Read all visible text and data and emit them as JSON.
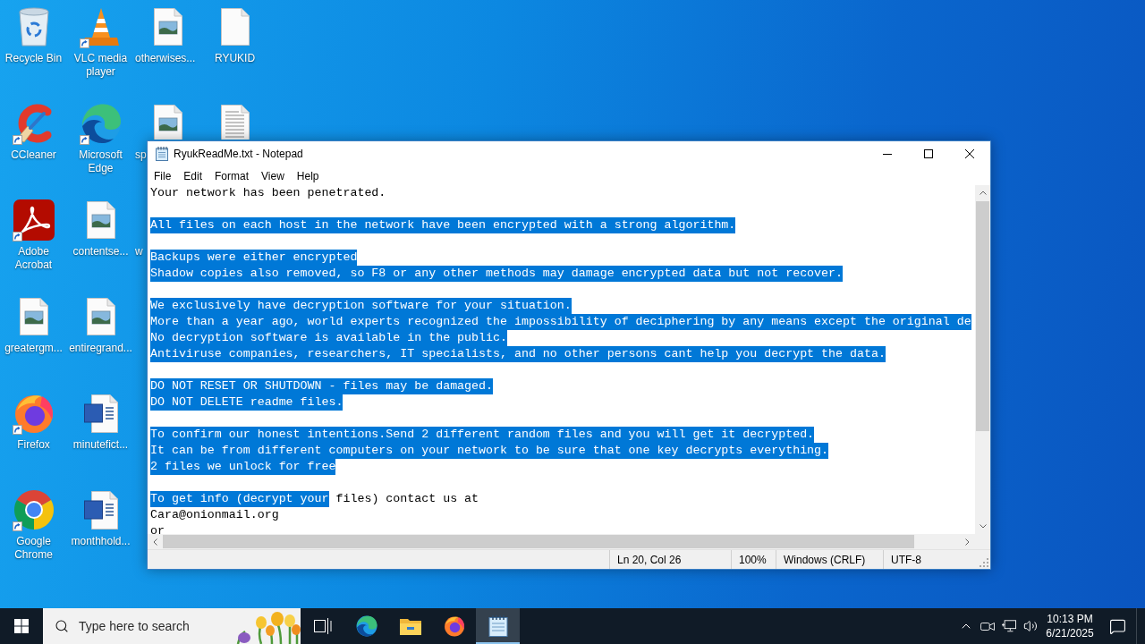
{
  "desktop": {
    "columns": [
      {
        "icons": [
          {
            "kind": "recycle-bin",
            "label": "Recycle Bin",
            "shortcut": false
          },
          {
            "kind": "ccleaner",
            "label": "CCleaner",
            "shortcut": true
          },
          {
            "kind": "acrobat",
            "label": "Adobe Acrobat",
            "shortcut": true
          },
          {
            "kind": "image-file",
            "label": "greatergm...",
            "shortcut": false
          },
          {
            "kind": "firefox",
            "label": "Firefox",
            "shortcut": true
          },
          {
            "kind": "chrome",
            "label": "Google Chrome",
            "shortcut": true
          }
        ]
      },
      {
        "icons": [
          {
            "kind": "vlc",
            "label": "VLC media player",
            "shortcut": true
          },
          {
            "kind": "edge",
            "label": "Microsoft Edge",
            "shortcut": true
          },
          {
            "kind": "image-file",
            "label": "contentse...",
            "shortcut": false
          },
          {
            "kind": "image-file",
            "label": "entiregrand...",
            "shortcut": false
          },
          {
            "kind": "word-document",
            "label": "minutefict...",
            "shortcut": false
          },
          {
            "kind": "word-document",
            "label": "monthhold...",
            "shortcut": false
          }
        ]
      },
      {
        "icons": [
          {
            "kind": "image-file",
            "label": "otherwises...",
            "shortcut": false
          },
          {
            "kind": "image-file",
            "label": "sp",
            "shortcut": false
          },
          {
            "label": "w"
          }
        ]
      },
      {
        "icons": [
          {
            "kind": "blank-file",
            "label": "RYUKID",
            "shortcut": false
          },
          {
            "kind": "text-file",
            "shortcut": false
          }
        ]
      }
    ]
  },
  "window": {
    "title": "RyukReadMe.txt - Notepad",
    "menu": [
      "File",
      "Edit",
      "Format",
      "View",
      "Help"
    ],
    "lines": [
      {
        "kind": "text",
        "spans": [
          {
            "text": "Your network has been penetrated.",
            "selected": false
          }
        ]
      },
      {
        "kind": "blank"
      },
      {
        "kind": "text",
        "spans": [
          {
            "text": "All files on each host in the network have been encrypted with a strong algorithm.",
            "selected": true
          }
        ]
      },
      {
        "kind": "blank"
      },
      {
        "kind": "text",
        "spans": [
          {
            "text": "Backups were either encrypted",
            "selected": true
          }
        ]
      },
      {
        "kind": "text",
        "spans": [
          {
            "text": "Shadow copies also removed, so F8 or any other methods may damage encrypted data but not recover.",
            "selected": true
          }
        ]
      },
      {
        "kind": "blank"
      },
      {
        "kind": "text",
        "spans": [
          {
            "text": "We exclusively have decryption software for your situation.",
            "selected": true
          }
        ]
      },
      {
        "kind": "text",
        "spans": [
          {
            "text": "More than a year ago, world experts recognized the impossibility of deciphering by any means except the original de",
            "selected": true
          }
        ]
      },
      {
        "kind": "text",
        "spans": [
          {
            "text": "No decryption software is available in the public.",
            "selected": true
          }
        ]
      },
      {
        "kind": "text",
        "spans": [
          {
            "text": "Antiviruse companies, researchers, IT specialists, and no other persons cant help you decrypt the data.",
            "selected": true
          }
        ]
      },
      {
        "kind": "blank"
      },
      {
        "kind": "text",
        "spans": [
          {
            "text": "DO NOT RESET OR SHUTDOWN - files may be damaged.",
            "selected": true
          }
        ]
      },
      {
        "kind": "text",
        "spans": [
          {
            "text": "DO NOT DELETE readme files.",
            "selected": true
          }
        ]
      },
      {
        "kind": "blank"
      },
      {
        "kind": "text",
        "spans": [
          {
            "text": "To confirm our honest intentions.Send 2 different random files and you will get it decrypted.",
            "selected": true
          }
        ]
      },
      {
        "kind": "text",
        "spans": [
          {
            "text": "It can be from different computers on your network to be sure that one key decrypts everything.",
            "selected": true
          }
        ]
      },
      {
        "kind": "text",
        "spans": [
          {
            "text": "2 files we unlock for free",
            "selected": true
          }
        ]
      },
      {
        "kind": "blank"
      },
      {
        "kind": "text",
        "spans": [
          {
            "text": "To get info (decrypt your",
            "selected": true
          },
          {
            "text": " files) contact us at",
            "selected": false
          }
        ]
      },
      {
        "kind": "text",
        "spans": [
          {
            "text": "Cara@onionmail.org",
            "selected": false
          }
        ]
      },
      {
        "kind": "text",
        "spans": [
          {
            "text": "or",
            "selected": false
          }
        ]
      }
    ],
    "status_bar": [
      "Ln 20, Col 26",
      "100%",
      "Windows (CRLF)",
      "UTF-8"
    ]
  },
  "taskbar": {
    "search": {
      "placeholder": "Type here to search"
    },
    "apps": [
      {
        "kind": "task-view",
        "selected": false
      },
      {
        "kind": "edge",
        "selected": false
      },
      {
        "kind": "file-explorer",
        "selected": false
      },
      {
        "kind": "firefox",
        "selected": false
      },
      {
        "kind": "notepad",
        "selected": true
      }
    ],
    "clock": {
      "time": "10:13 PM",
      "date": "6/21/2025"
    }
  }
}
